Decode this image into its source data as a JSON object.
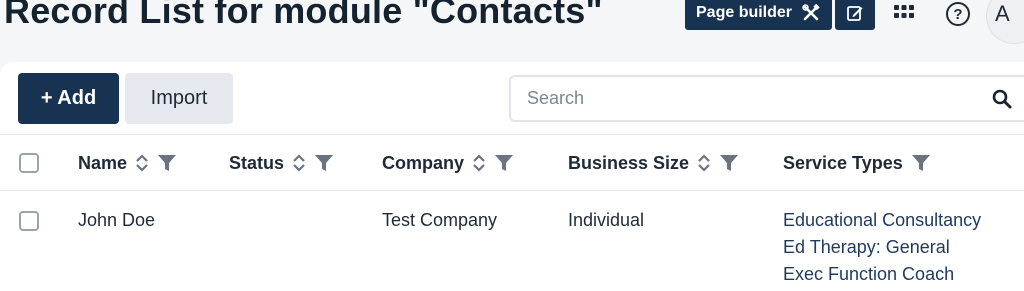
{
  "header": {
    "title": "Record List for module \"Contacts\"",
    "page_builder_label": "Page builder",
    "help_symbol": "?",
    "avatar_initial": "A"
  },
  "toolbar": {
    "add_label": "+ Add",
    "import_label": "Import",
    "search_placeholder": "Search"
  },
  "table": {
    "columns": [
      {
        "label": "Name",
        "sortable": true,
        "filterable": true
      },
      {
        "label": "Status",
        "sortable": true,
        "filterable": true
      },
      {
        "label": "Company",
        "sortable": true,
        "filterable": true
      },
      {
        "label": "Business Size",
        "sortable": true,
        "filterable": true
      },
      {
        "label": "Service Types",
        "sortable": false,
        "filterable": true
      }
    ],
    "rows": [
      {
        "name": "John Doe",
        "status": "",
        "company": "Test Company",
        "business_size": "Individual",
        "service_types": [
          "Educational Consultancy",
          "Ed Therapy: General",
          "Exec Function Coach"
        ]
      }
    ]
  },
  "icons": {
    "page_builder": "tools-icon",
    "edit": "edit-icon",
    "apps": "grid-icon",
    "help": "help-icon",
    "search": "search-icon",
    "sort": "sort-icon",
    "filter": "filter-icon"
  },
  "colors": {
    "primary": "#173351",
    "link": "#1e3a5f",
    "secondary_button": "#e6e9ef",
    "background": "#f5f6f8"
  }
}
